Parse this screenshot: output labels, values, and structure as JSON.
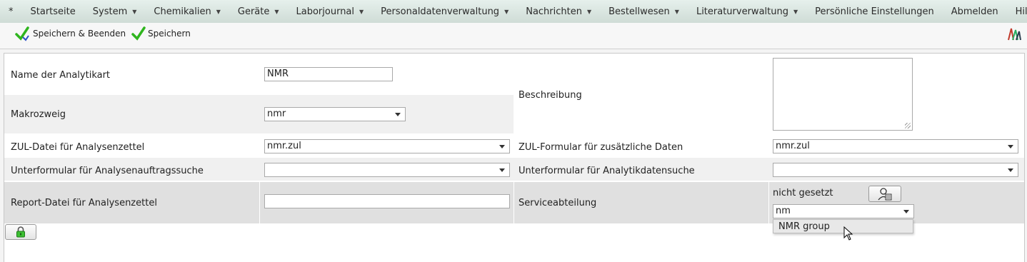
{
  "menu": {
    "items": [
      {
        "label": "*",
        "has_caret": false
      },
      {
        "label": "Startseite",
        "has_caret": false
      },
      {
        "label": "System",
        "has_caret": true
      },
      {
        "label": "Chemikalien",
        "has_caret": true
      },
      {
        "label": "Geräte",
        "has_caret": true
      },
      {
        "label": "Laborjournal",
        "has_caret": true
      },
      {
        "label": "Personaldatenverwaltung",
        "has_caret": true
      },
      {
        "label": "Nachrichten",
        "has_caret": true
      },
      {
        "label": "Bestellwesen",
        "has_caret": true
      },
      {
        "label": "Literaturverwaltung",
        "has_caret": true
      },
      {
        "label": "Persönliche Einstellungen",
        "has_caret": false
      },
      {
        "label": "Abmelden",
        "has_caret": false
      },
      {
        "label": "Hilfe",
        "has_caret": false
      }
    ]
  },
  "toolbar": {
    "save_close_label": "Speichern & Beenden",
    "save_label": "Speichern"
  },
  "form": {
    "name_label": "Name der Analytikart",
    "name_value": "NMR",
    "beschreibung_label": "Beschreibung",
    "beschreibung_value": "",
    "makrozweig_label": "Makrozweig",
    "makrozweig_value": "nmr",
    "zul_label": "ZUL-Datei für Analysenzettel",
    "zul_value": "nmr.zul",
    "zul_formular_label": "ZUL-Formular für zusätzliche Daten",
    "zul_formular_value": "nmr.zul",
    "unterformular_auftrag_label": "Unterformular für Analysenauftragssuche",
    "unterformular_auftrag_value": "",
    "unterformular_daten_label": "Unterformular für Analytikdatensuche",
    "unterformular_daten_value": "",
    "report_label": "Report-Datei für Analysenzettel",
    "report_value": "",
    "service_label": "Serviceabteilung",
    "service_status": "nicht gesetzt",
    "service_select_value": "nm",
    "service_option": "NMR group"
  },
  "colors": {
    "menubar": "#d8e6e0",
    "shaded_row": "#f0f0f0",
    "dark_row": "#e0e0e0",
    "check_green": "#2fb51e"
  }
}
